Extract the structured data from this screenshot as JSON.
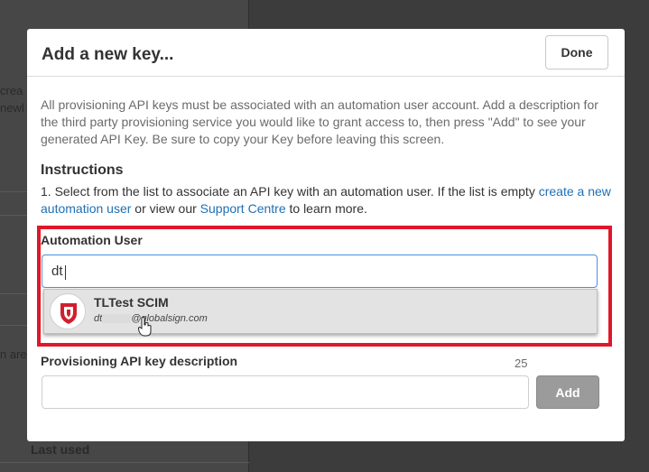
{
  "background": {
    "text_1": "crea",
    "text_2": "newl",
    "text_3": "n are",
    "last_used": "Last used"
  },
  "modal": {
    "title": "Add a new key...",
    "done_label": "Done",
    "intro": "All provisioning API keys must be associated with an automation user account. Add a description for the third party provisioning service you would like to grant access to, then press \"Add\" to see your generated API Key. Be sure to copy your Key before leaving this screen.",
    "instructions_heading": "Instructions",
    "instructions": {
      "part1": "1. Select from the list to associate an API key with an automation user. If the list is empty ",
      "link1": "create a new automation user",
      "part2": " or view our ",
      "link2": "Support Centre",
      "part3": " to learn more."
    },
    "automation_user": {
      "label": "Automation User",
      "value": "dt",
      "dropdown_items": [
        {
          "name": "TLTest SCIM",
          "email_prefix": "dt",
          "email_domain": "@globalsign.com"
        }
      ]
    },
    "description": {
      "label": "Provisioning API key description",
      "char_count": "25",
      "value": ""
    },
    "add_label": "Add"
  },
  "colors": {
    "highlight": "#e0172b",
    "link": "#1f6fb5",
    "input_focus": "#4a90d9"
  }
}
